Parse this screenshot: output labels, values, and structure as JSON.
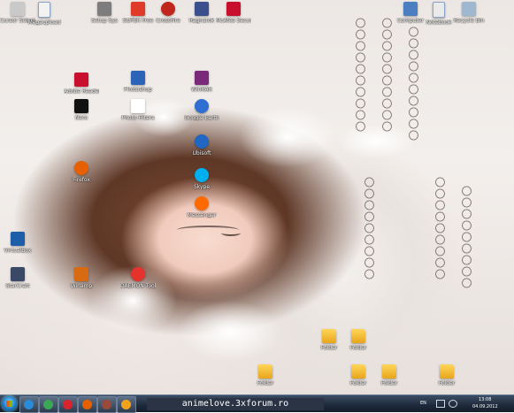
{
  "desktop_icons": [
    {
      "label": "Cursor Selection",
      "glyph": "#c9c9c9",
      "shape": "",
      "icon": "cursor-icon"
    },
    {
      "label": "Megaupload",
      "glyph": "#f2f2f2",
      "shape": "doc",
      "icon": "document-icon"
    },
    {
      "label": "Setup Sys",
      "glyph": "#7d7d7d",
      "shape": "",
      "icon": "setup-icon"
    },
    {
      "label": "SUPER Free",
      "glyph": "#e03b2a",
      "shape": "",
      "icon": "super-icon"
    },
    {
      "label": "CrossFire",
      "glyph": "#c0261c",
      "shape": "round",
      "icon": "crossfire-icon"
    },
    {
      "label": "Ragnarok",
      "glyph": "#3b4f8c",
      "shape": "",
      "icon": "ragnarok-icon"
    },
    {
      "label": "McAfee Security",
      "glyph": "#c8102e",
      "shape": "",
      "icon": "mcafee-icon"
    },
    {
      "label": "Computer",
      "glyph": "#4b7fbf",
      "shape": "",
      "icon": "computer-icon"
    },
    {
      "label": "Notebook",
      "glyph": "#eaeaea",
      "shape": "doc",
      "icon": "notebook-icon"
    },
    {
      "label": "Recycle Bin",
      "glyph": "#9fb7cf",
      "shape": "",
      "icon": "recycle-bin-icon"
    },
    {
      "label": "Photoshop",
      "glyph": "#2a63b7",
      "shape": "",
      "icon": "photoshop-icon"
    },
    {
      "label": "WinRAR",
      "glyph": "#7b2a7a",
      "shape": "",
      "icon": "winrar-icon"
    },
    {
      "label": "Nero",
      "glyph": "#111111",
      "shape": "",
      "icon": "nero-icon"
    },
    {
      "label": "Adobe Reader",
      "glyph": "#c8102e",
      "shape": "",
      "icon": "adobe-reader-icon"
    },
    {
      "label": "Photo Filters",
      "glyph": "#ffffff",
      "shape": "",
      "icon": "photo-filters-icon"
    },
    {
      "label": "Google Earth",
      "glyph": "#2e6fd1",
      "shape": "round",
      "icon": "google-earth-icon"
    },
    {
      "label": "Ubisoft",
      "glyph": "#2166c0",
      "shape": "round",
      "icon": "ubisoft-icon"
    },
    {
      "label": "Skype",
      "glyph": "#00aff0",
      "shape": "round",
      "icon": "skype-icon"
    },
    {
      "label": "Messenger",
      "glyph": "#ff6a00",
      "shape": "round",
      "icon": "messenger-icon"
    },
    {
      "label": "Firefox",
      "glyph": "#e66000",
      "shape": "round",
      "icon": "firefox-icon"
    },
    {
      "label": "VirtualBox",
      "glyph": "#1d5ea8",
      "shape": "",
      "icon": "virtualbox-icon"
    },
    {
      "label": "StarCraft",
      "glyph": "#3a4a66",
      "shape": "",
      "icon": "starcraft-icon"
    },
    {
      "label": "Winamp",
      "glyph": "#d96a14",
      "shape": "",
      "icon": "winamp-icon"
    },
    {
      "label": "DAEMON Tools",
      "glyph": "#e6322d",
      "shape": "round",
      "icon": "daemon-tools-icon"
    },
    {
      "label": "Folder",
      "glyph": "",
      "shape": "folder",
      "icon": "folder-icon"
    },
    {
      "label": "Folder",
      "glyph": "",
      "shape": "folder",
      "icon": "folder-icon"
    },
    {
      "label": "Folder",
      "glyph": "",
      "shape": "folder",
      "icon": "folder-icon"
    },
    {
      "label": "Folder",
      "glyph": "",
      "shape": "folder",
      "icon": "folder-icon"
    },
    {
      "label": "Folder",
      "glyph": "",
      "shape": "folder",
      "icon": "folder-icon"
    },
    {
      "label": "Folder",
      "glyph": "",
      "shape": "folder",
      "icon": "folder-icon"
    }
  ],
  "taskbar": {
    "forum_label": "animelove.3xforum.ro",
    "apps": [
      {
        "name": "Internet Explorer",
        "color": "#2a8ad8",
        "icon": "internet-explorer-icon"
      },
      {
        "name": "Chrome",
        "color": "#3aa757",
        "icon": "chrome-icon"
      },
      {
        "name": "Opera",
        "color": "#d9232e",
        "icon": "opera-icon"
      },
      {
        "name": "Firefox",
        "color": "#e66000",
        "icon": "firefox-icon"
      },
      {
        "name": "Game",
        "color": "#9a4a3a",
        "icon": "game-icon"
      },
      {
        "name": "Media Player",
        "color": "#f2a31b",
        "icon": "media-player-icon"
      },
      {
        "name": "Explorer",
        "color": "#6aa0d8",
        "icon": "explorer-icon"
      }
    ],
    "tray": {
      "lang": "EN",
      "time": "13:08",
      "date": "04.09.2012"
    }
  }
}
